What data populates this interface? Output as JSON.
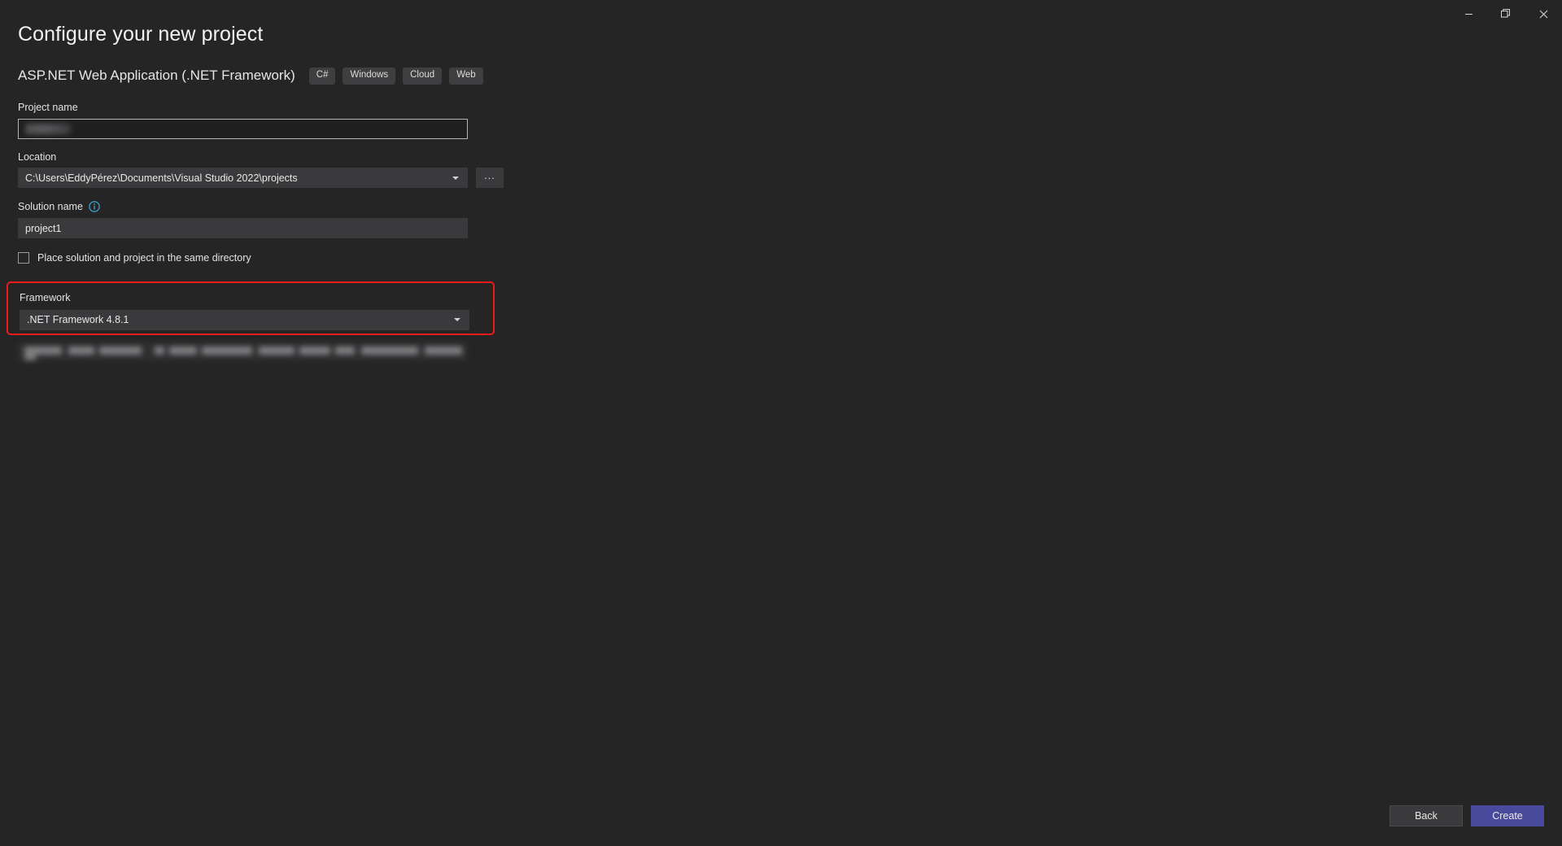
{
  "window": {
    "controls": [
      {
        "name": "minimize",
        "label": "Minimize"
      },
      {
        "name": "restore",
        "label": "Restore"
      },
      {
        "name": "close",
        "label": "Close"
      }
    ]
  },
  "header": {
    "title": "Configure your new project",
    "template_name": "ASP.NET Web Application (.NET Framework)",
    "tags": [
      "C#",
      "Windows",
      "Cloud",
      "Web"
    ]
  },
  "form": {
    "project_name": {
      "label": "Project name",
      "value": "",
      "redacted": true
    },
    "location": {
      "label": "Location",
      "value": "C:\\Users\\EddyPérez\\Documents\\Visual Studio 2022\\projects",
      "browse_label": "..."
    },
    "solution_name": {
      "label": "Solution name",
      "value": "project1",
      "info_icon": "info-icon"
    },
    "same_directory": {
      "label": "Place solution and project in the same directory",
      "checked": false
    },
    "framework": {
      "label": "Framework",
      "value": ".NET Framework 4.8.1",
      "highlighted": true,
      "highlight_color": "#ee1b1b"
    },
    "footnote": {
      "redacted": true,
      "value": ""
    }
  },
  "footer": {
    "back_label": "Back",
    "create_label": "Create"
  },
  "colors": {
    "background": "#252526",
    "field": "#3a3a3c",
    "accent": "#4a4a9c",
    "highlight": "#ee1b1b",
    "info": "#3aa8d8"
  }
}
